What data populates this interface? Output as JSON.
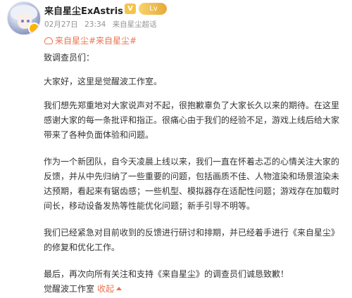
{
  "author": {
    "name": "来自星尘ExAstris",
    "vip_badge": "V",
    "level_badge": " Lv"
  },
  "meta": {
    "date": "02月27日",
    "time": "23:34",
    "source_prefix": "来自",
    "source": "来自星尘超话"
  },
  "topic": {
    "label": "来自星尘#来自星尘#"
  },
  "post": {
    "greeting": "致调查员们：",
    "p1": "大家好，这里是觉醒波工作室。",
    "p2": "我们想先郑重地对大家说声对不起，很抱歉辜负了大家长久以来的期待。在这里感谢大家的每一条批评和指正。很痛心由于我们的经验不足，游戏上线后给大家带来了各种负面体验和问题。",
    "p3": "作为一个新团队，自今天凌晨上线以来，我们一直在怀着忐忑的心情关注大家的反馈，并从中先归纳了一些重要的问题，包括画质不佳、人物渲染和场景渲染未达预期，看起来有锯齿感；一些机型、模拟器存在适配性问题；游戏存在加载时间长，移动设备发热等性能优化问题；新手引导不明等。",
    "p4": "我们已经紧急对目前收到的反馈进行研讨和排期，并已经着手进行《来自星尘》的修复和优化工作。",
    "p5": "最后，再次向所有关注和支持《来自星尘》的调查员们诚恳致歉！"
  },
  "signature": {
    "text": "觉醒波工作室",
    "collapse_label": "收起"
  },
  "colors": {
    "accent": "#eb7350",
    "text": "#333333",
    "meta": "#939393"
  }
}
